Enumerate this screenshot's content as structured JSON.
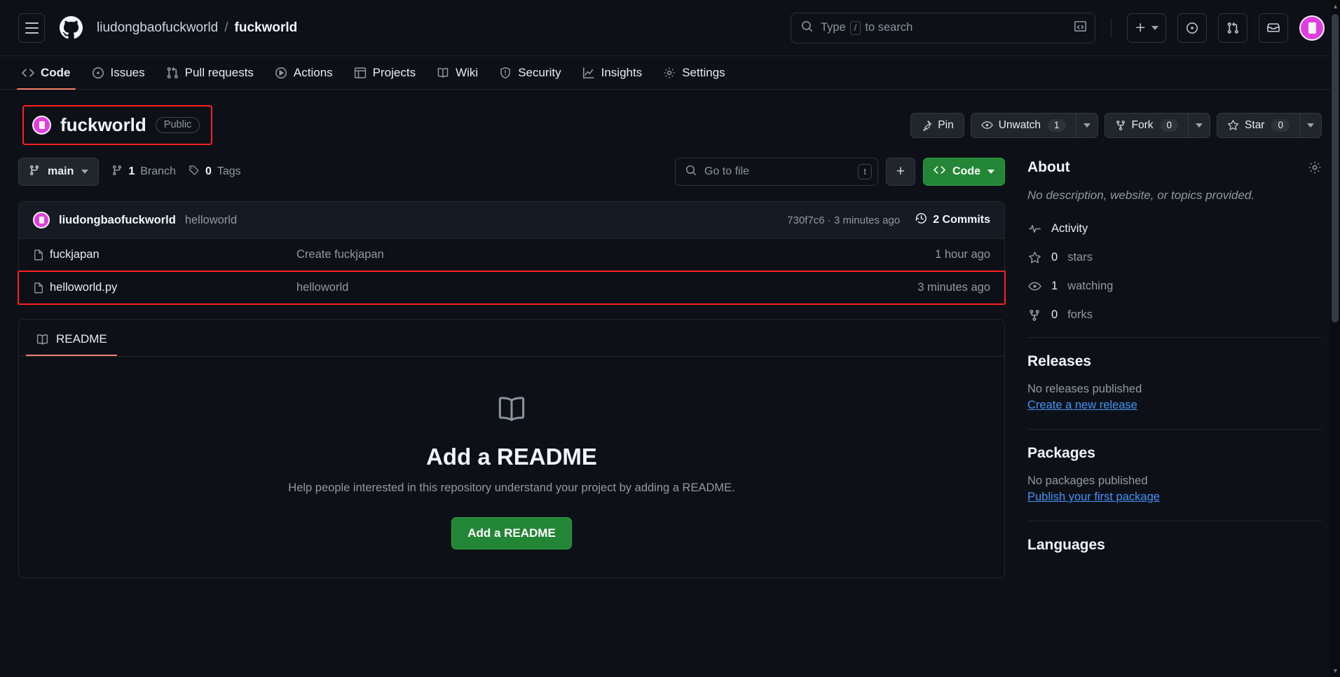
{
  "header": {
    "menu_icon": "hamburger-icon",
    "logo_icon": "github-mark-icon",
    "owner": "liudongbaofuckworld",
    "separator": "/",
    "repo": "fuckworld",
    "search_placeholder": "Type",
    "search_kbd": "/",
    "search_placeholder_tail": "to search",
    "terminal_icon": "terminal-icon",
    "create_new_label": "+",
    "issues_icon": "issues-icon",
    "pull_requests_icon": "pull-request-icon",
    "inbox_icon": "inbox-icon",
    "avatar": "user-avatar"
  },
  "nav": {
    "tabs": [
      {
        "label": "Code",
        "icon": "code-icon",
        "active": true
      },
      {
        "label": "Issues",
        "icon": "issue-opened-icon",
        "active": false
      },
      {
        "label": "Pull requests",
        "icon": "git-pull-request-icon",
        "active": false
      },
      {
        "label": "Actions",
        "icon": "play-icon",
        "active": false
      },
      {
        "label": "Projects",
        "icon": "table-icon",
        "active": false
      },
      {
        "label": "Wiki",
        "icon": "book-icon",
        "active": false
      },
      {
        "label": "Security",
        "icon": "shield-icon",
        "active": false
      },
      {
        "label": "Insights",
        "icon": "graph-icon",
        "active": false
      },
      {
        "label": "Settings",
        "icon": "gear-icon",
        "active": false
      }
    ]
  },
  "repo_header": {
    "name": "fuckworld",
    "visibility": "Public",
    "pin_label": "Pin",
    "watch_label": "Unwatch",
    "watch_count": "1",
    "fork_label": "Fork",
    "fork_count": "0",
    "star_label": "Star",
    "star_count": "0"
  },
  "toolbar": {
    "branch": "main",
    "branch_count": "1",
    "branch_label": "Branch",
    "tag_count": "0",
    "tag_label": "Tags",
    "go_to_file_placeholder": "Go to file",
    "go_to_file_kbd": "t",
    "add_file_label": "+",
    "code_label": "Code"
  },
  "commit_bar": {
    "author": "liudongbaofuckworld",
    "message": "helloworld",
    "hash_and_time": "730f7c6 · 3 minutes ago",
    "commits_count": "2 Commits"
  },
  "files": [
    {
      "name": "fuckjapan",
      "commit": "Create fuckjapan",
      "time": "1 hour ago",
      "highlighted": false
    },
    {
      "name": "helloworld.py",
      "commit": "helloworld",
      "time": "3 minutes ago",
      "highlighted": true
    }
  ],
  "readme": {
    "tab_label": "README",
    "title": "Add a README",
    "subtitle": "Help people interested in this repository understand your project by adding a README.",
    "cta_label": "Add a README"
  },
  "sidebar": {
    "about_title": "About",
    "settings_icon": "gear-icon",
    "description": "No description, website, or topics provided.",
    "stats": [
      {
        "label": "Activity",
        "value": "",
        "icon": "pulse-icon"
      },
      {
        "label": "stars",
        "value": "0",
        "icon": "star-icon"
      },
      {
        "label": "watching",
        "value": "1",
        "icon": "eye-icon"
      },
      {
        "label": "forks",
        "value": "0",
        "icon": "fork-icon"
      }
    ],
    "releases_title": "Releases",
    "releases_empty": "No releases published",
    "releases_link": "Create a new release",
    "packages_title": "Packages",
    "packages_empty": "No packages published",
    "packages_link": "Publish your first package",
    "languages_title": "Languages"
  },
  "colors": {
    "page_bg": "#0d1117",
    "accent_green": "#238636",
    "link_blue": "#4493f8",
    "annotation_red": "#ff2020",
    "tab_underline": "#f78166",
    "avatar_magenta": "#e13ee1"
  }
}
